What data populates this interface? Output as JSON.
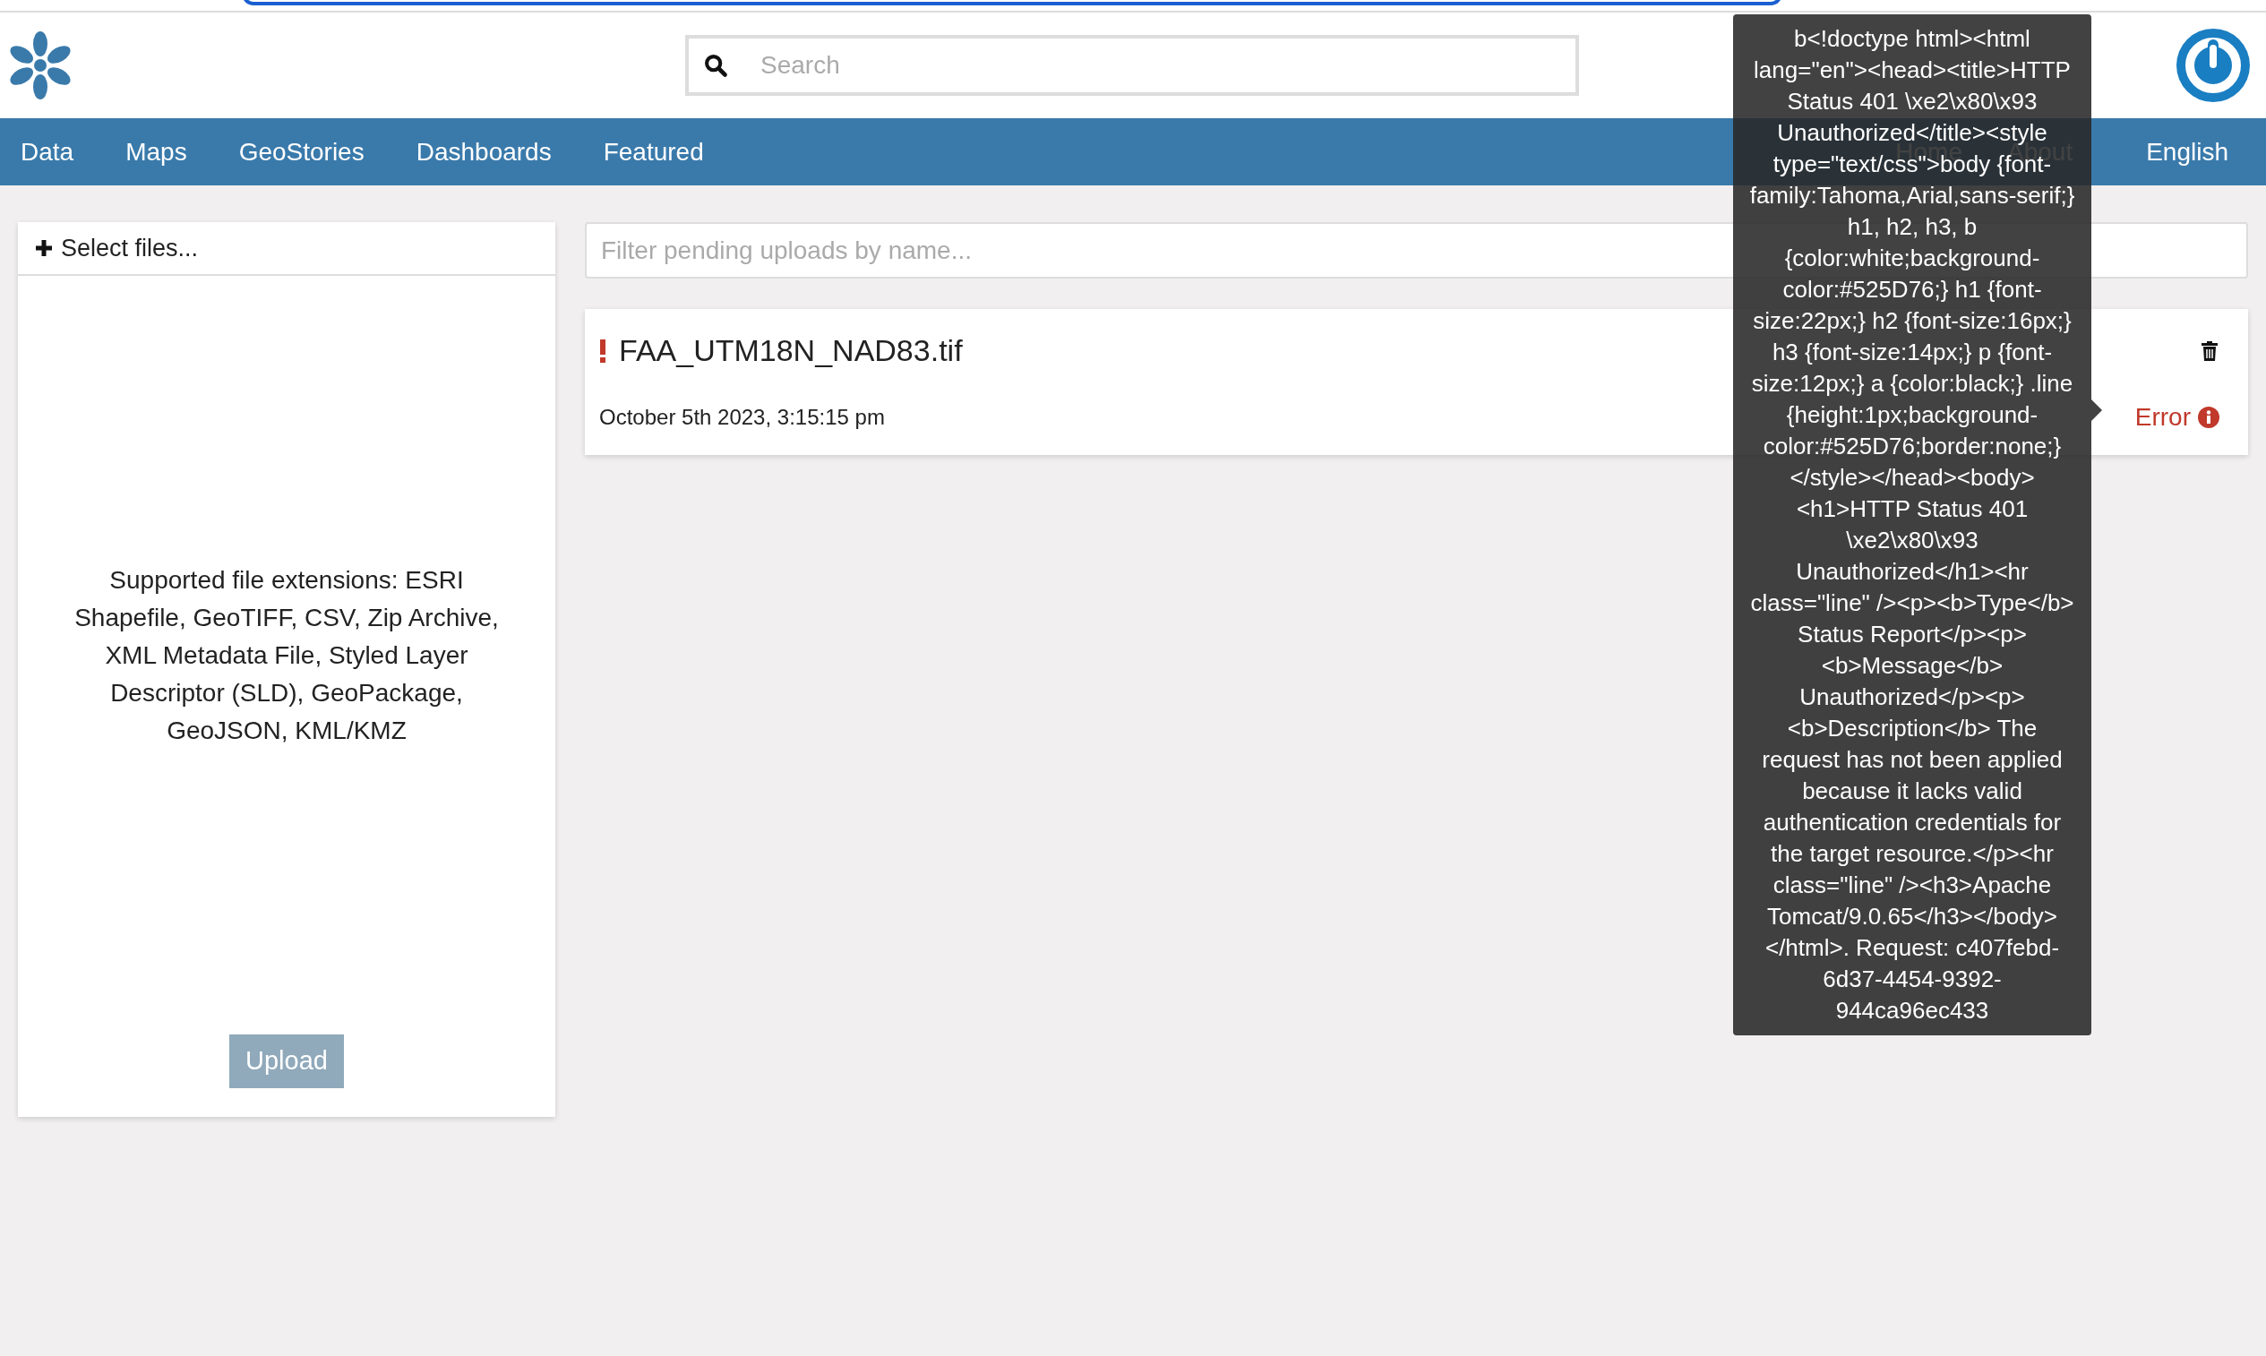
{
  "header": {
    "search": {
      "placeholder": "Search"
    }
  },
  "nav": {
    "left": [
      {
        "label": "Data"
      },
      {
        "label": "Maps"
      },
      {
        "label": "GeoStories"
      },
      {
        "label": "Dashboards"
      },
      {
        "label": "Featured"
      }
    ],
    "right": [
      {
        "label": "Home"
      },
      {
        "label": "About"
      }
    ],
    "language": "English"
  },
  "upload_panel": {
    "select_label": "Select files...",
    "supported": "Supported file extensions: ESRI Shapefile, GeoTIFF, CSV, Zip Archive, XML Metadata File, Styled Layer Descriptor (SLD), GeoPackage, GeoJSON, KML/KMZ",
    "upload_button": {
      "label": "Upload",
      "disabled": true
    }
  },
  "pending": {
    "filter": {
      "placeholder": "Filter pending uploads by name..."
    },
    "items": [
      {
        "name": "FAA_UTM18N_NAD83.tif",
        "date": "October 5th 2023, 3:15:15 pm",
        "status": "Error",
        "failed": true
      }
    ]
  },
  "tooltip": {
    "text": "b<!doctype html><html lang=\"en\"><head><title>HTTP Status 401 \\xe2\\x80\\x93 Unauthorized</title><style type=\"text/css\">body {font-family:Tahoma,Arial,sans-serif;} h1, h2, h3, b {color:white;background-color:#525D76;} h1 {font-size:22px;} h2 {font-size:16px;} h3 {font-size:14px;} p {font-size:12px;} a {color:black;} .line {height:1px;background-color:#525D76;border:none;} </style></head><body><h1>HTTP Status 401 \\xe2\\x80\\x93 Unauthorized</h1><hr class=\"line\" /><p><b>Type</b> Status Report</p><p><b>Message</b> Unauthorized</p><p><b>Description</b> The request has not been applied because it lacks valid authentication credentials for the target resource.</p><hr class=\"line\" /><h3>Apache Tomcat/9.0.65</h3></body></html>. Request: c407febd-6d37-4454-9392-944ca96ec433"
  }
}
